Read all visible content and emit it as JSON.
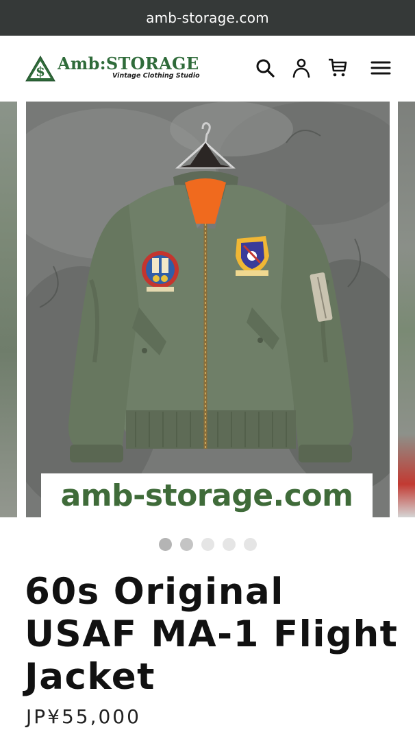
{
  "browser": {
    "url": "amb-storage.com"
  },
  "header": {
    "logo_text": "Amb:STORAGE",
    "logo_tagline": "Vintage Clothing Studio",
    "icons": [
      "search-icon",
      "account-icon",
      "cart-icon",
      "menu-icon"
    ]
  },
  "gallery": {
    "watermark": "amb-storage.com",
    "slide_count": 5,
    "active_index": 0
  },
  "product": {
    "title": "60s Original USAF MA-1 Flight Jacket",
    "price": "JP¥55,000"
  },
  "colors": {
    "url_bar_bg": "#353938",
    "brand_green": "#2f6b3a",
    "watermark_green": "#3f6b39",
    "jacket_green": "#6f7f68",
    "lining_orange": "#f06a1e"
  }
}
